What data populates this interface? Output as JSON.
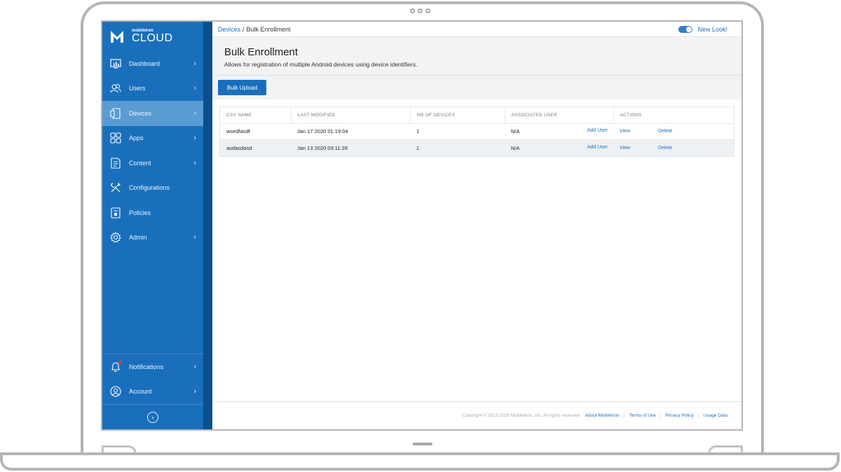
{
  "brand": {
    "small": "mobileiron",
    "big": "CLOUD"
  },
  "sidebar": {
    "items": [
      {
        "label": "Dashboard",
        "icon": "dashboard-icon",
        "has_chevron": true,
        "active": false
      },
      {
        "label": "Users",
        "icon": "users-icon",
        "has_chevron": true,
        "active": false
      },
      {
        "label": "Devices",
        "icon": "devices-icon",
        "has_chevron": true,
        "active": true
      },
      {
        "label": "Apps",
        "icon": "apps-icon",
        "has_chevron": true,
        "active": false
      },
      {
        "label": "Content",
        "icon": "content-icon",
        "has_chevron": true,
        "active": false
      },
      {
        "label": "Configurations",
        "icon": "configurations-icon",
        "has_chevron": false,
        "active": false
      },
      {
        "label": "Policies",
        "icon": "policies-icon",
        "has_chevron": false,
        "active": false
      },
      {
        "label": "Admin",
        "icon": "gear-icon",
        "has_chevron": true,
        "active": false
      }
    ],
    "bottom_items": [
      {
        "label": "Notifications",
        "icon": "bell-icon",
        "has_chevron": true
      },
      {
        "label": "Account",
        "icon": "account-icon",
        "has_chevron": true
      }
    ],
    "chevron": "›",
    "collapse_glyph": "‹"
  },
  "breadcrumb": {
    "parent": "Devices",
    "separator": "/",
    "current": "Bulk Enrollment"
  },
  "toggle": {
    "label": "New Look!",
    "on": true
  },
  "header": {
    "title": "Bulk Enrollment",
    "subtitle": "Allows for registration of multiple Android devices using device identifiers."
  },
  "toolbar": {
    "bulk_upload_label": "Bulk Upload"
  },
  "table": {
    "columns": [
      "CSV NAME",
      "LAST MODIFIED",
      "NO OF DEVICES",
      "ASSOCIATED USER",
      "ACTIONS"
    ],
    "rows": [
      {
        "csv_name": "wsedfasdf",
        "last_modified": "Jan 17 2020 01:19:04",
        "devices": "1",
        "user": "N/A",
        "add_user": "Add User",
        "view": "View",
        "delete": "Delete"
      },
      {
        "csv_name": "asdasdasd",
        "last_modified": "Jan 13 2020 03:11:26",
        "devices": "1",
        "user": "N/A",
        "add_user": "Add User",
        "view": "View",
        "delete": "Delete"
      }
    ]
  },
  "footer": {
    "copyright": "Copyright © 2013-2020 MobileIron, Inc. All rights reserved.",
    "links": [
      "About MobileIron",
      "Terms of Use",
      "Privacy Policy",
      "Usage Data"
    ],
    "separator": "|"
  },
  "colors": {
    "sidebar": "#1a6fbc",
    "sidebar_edge": "#0b4f8d",
    "sidebar_active": "#5a9bd4",
    "accent": "#1d6fc0",
    "notification_dot": "#e23b3b"
  }
}
